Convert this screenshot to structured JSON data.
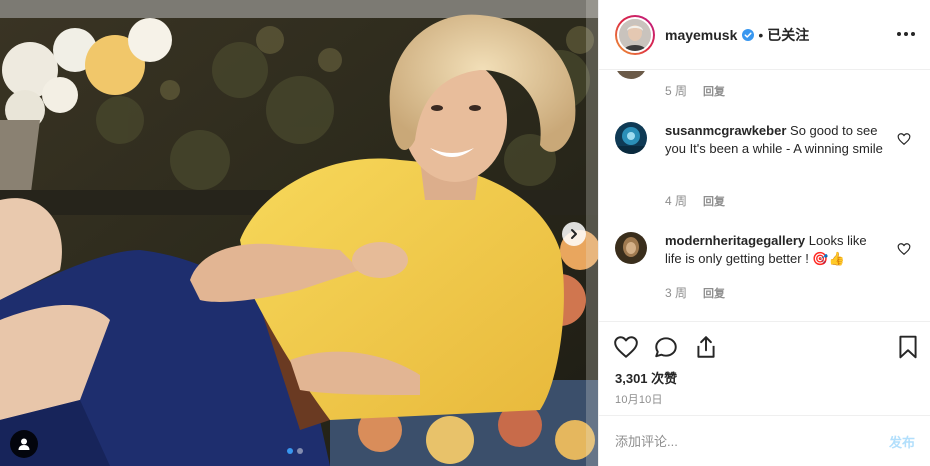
{
  "post": {
    "username": "mayemusk",
    "separator": "•",
    "follow_state": "已关注"
  },
  "earlier_comment": {
    "time": "5 周",
    "reply_label": "回复"
  },
  "comments": [
    {
      "username": "susanmcgrawkeber",
      "text": "So good to see you It's been a while - A winning smile",
      "time": "4 周",
      "reply_label": "回复"
    },
    {
      "username": "modernheritagegallery",
      "text": "Looks like life is only getting better ! 🎯👍",
      "time": "3 周",
      "reply_label": "回复"
    }
  ],
  "stats": {
    "likes": "3,301 次赞",
    "date": "10月10日"
  },
  "comment_box": {
    "placeholder": "添加评论...",
    "post_label": "发布"
  },
  "colors": {
    "verified_blue": "#3897f0",
    "post_button_disabled": "#b2dffc",
    "meta_gray": "#8e8e8e"
  },
  "icons": [
    "next-arrow-icon",
    "user-tag-icon",
    "verified-badge-icon",
    "more-options-icon",
    "heart-icon",
    "comment-icon",
    "share-icon",
    "bookmark-icon"
  ]
}
